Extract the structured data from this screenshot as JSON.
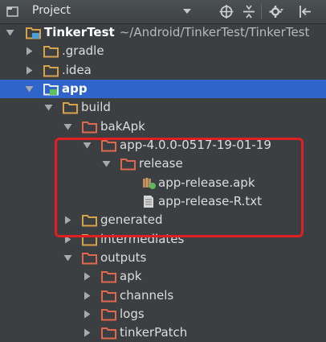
{
  "panel": {
    "title": "Project",
    "toolbar": {
      "icons": [
        "locate-icon",
        "collapse-all-icon",
        "gear-icon",
        "hide-icon"
      ]
    }
  },
  "tree": {
    "root_label": "TinkerTest",
    "root_path": "~/Android/TinkerTest/TinkerTest",
    "gradle": ".gradle",
    "idea": ".idea",
    "app": "app",
    "build": "build",
    "bakApk": "bakApk",
    "bak_subfolder": "app-4.0.0-0517-19-01-19",
    "release": "release",
    "apk_file": "app-release.apk",
    "txt_file": "app-release-R.txt",
    "generated": "generated",
    "intermediates": "intermediates",
    "outputs": "outputs",
    "out_apk": "apk",
    "out_channels": "channels",
    "out_logs": "logs",
    "out_tinkerPatch": "tinkerPatch"
  },
  "colors": {
    "background": "#3c3f41",
    "selection": "#2f65ca",
    "folder": "#d8a24a",
    "excluded_folder": "#e0684d",
    "highlight_box": "#e02020"
  }
}
